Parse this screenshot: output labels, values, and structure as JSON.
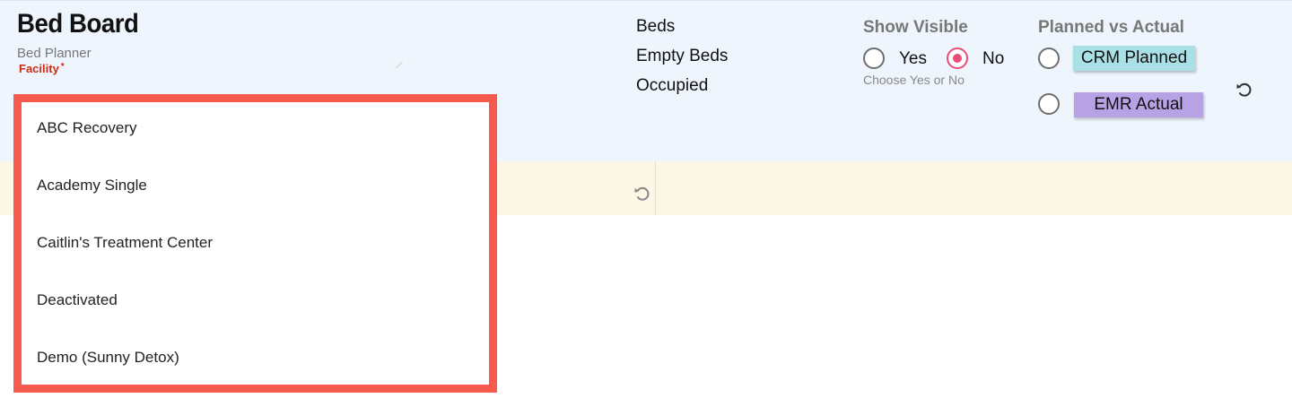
{
  "header": {
    "title": "Bed Board",
    "subtitle": "Bed Planner",
    "facility_label": "Facility",
    "required_marker": "*"
  },
  "stats": {
    "beds": "Beds",
    "empty_beds": "Empty Beds",
    "occupied": "Occupied"
  },
  "show_visible": {
    "title": "Show Visible",
    "options": [
      {
        "label": "Yes",
        "checked": false
      },
      {
        "label": "No",
        "checked": true
      }
    ],
    "helper": "Choose Yes or No"
  },
  "planned_vs_actual": {
    "title": "Planned vs Actual",
    "options": [
      {
        "label": "CRM Planned",
        "color": "#a9e0e6",
        "checked": false
      },
      {
        "label": "EMR Actual",
        "color": "#b7a2e6",
        "checked": false
      }
    ]
  },
  "facility_dropdown": {
    "highlight_color": "#f65a4f",
    "options": [
      "ABC Recovery",
      "Academy Single",
      "Caitlin's Treatment Center",
      "Deactivated",
      "Demo (Sunny Detox)"
    ]
  },
  "colors": {
    "header_bg": "#eef5fd",
    "strip_bg": "#fcf7e4",
    "required_red": "#cc2b14",
    "radio_accent": "#e84e76"
  },
  "icons": {
    "reset": "undo-icon"
  }
}
